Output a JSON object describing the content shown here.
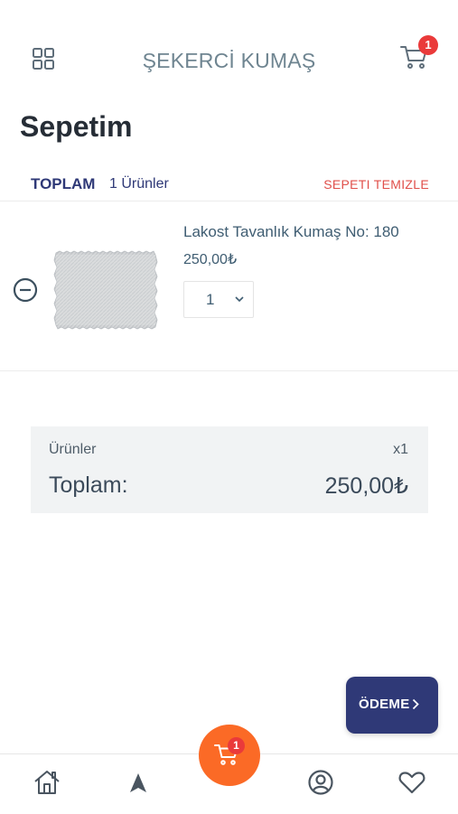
{
  "header": {
    "brand": "ŞEKERCİ KUMAŞ",
    "cart_count": "1",
    "menu_icon": "grid-icon",
    "cart_icon": "cart-icon"
  },
  "page": {
    "title": "Sepetim"
  },
  "summary": {
    "label": "TOPLAM",
    "count_text": "1 Ürünler",
    "clear_label": "SEPETI TEMIZLE"
  },
  "cart_item": {
    "name": "Lakost Tavanlık Kumaş No: 180",
    "price": "250,00₺",
    "quantity": "1",
    "remove_icon": "minus-circle-icon"
  },
  "totals": {
    "items_label": "Ürünler",
    "items_count": "x1",
    "total_label": "Toplam:",
    "total_value": "250,00₺"
  },
  "checkout": {
    "label": "ÖDEME"
  },
  "bottom_nav": {
    "cart_count": "1",
    "items": [
      "home-icon",
      "navigation-arrow-icon",
      "cart-icon",
      "user-circle-icon",
      "heart-icon"
    ]
  },
  "colors": {
    "primary": "#2f3977",
    "accent": "#fb6a26",
    "danger": "#e04f4a",
    "badge": "#ea3a3a"
  }
}
